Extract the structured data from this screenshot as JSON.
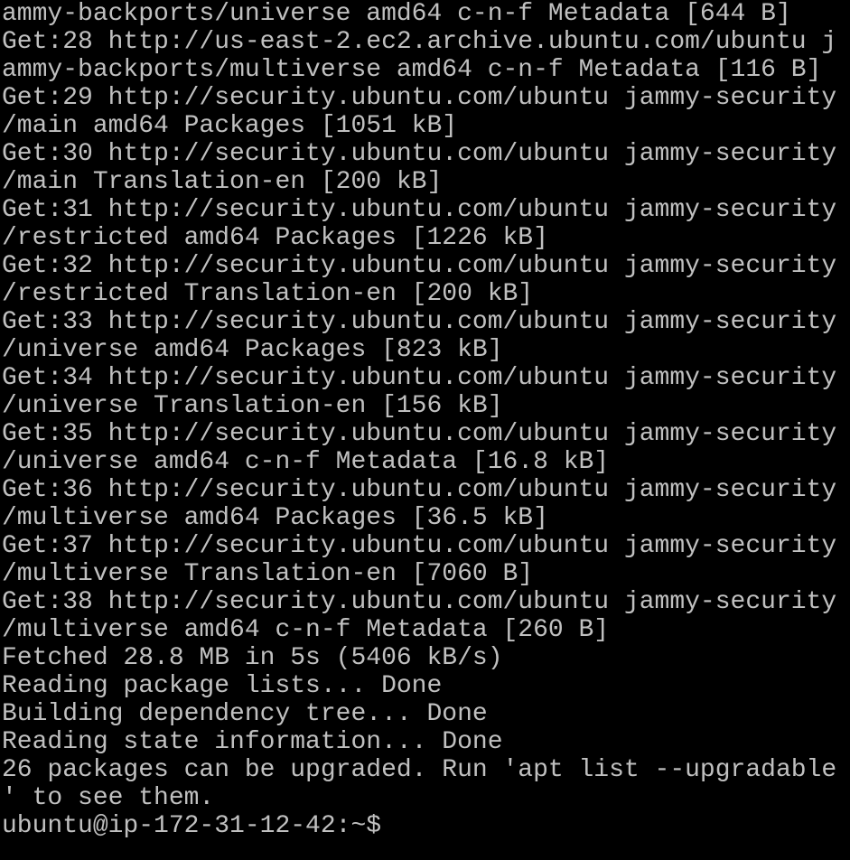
{
  "terminal": {
    "lines": [
      "ammy-backports/universe amd64 c-n-f Metadata [644 B]",
      "Get:28 http://us-east-2.ec2.archive.ubuntu.com/ubuntu j",
      "ammy-backports/multiverse amd64 c-n-f Metadata [116 B]",
      "Get:29 http://security.ubuntu.com/ubuntu jammy-security",
      "/main amd64 Packages [1051 kB]",
      "Get:30 http://security.ubuntu.com/ubuntu jammy-security",
      "/main Translation-en [200 kB]",
      "Get:31 http://security.ubuntu.com/ubuntu jammy-security",
      "/restricted amd64 Packages [1226 kB]",
      "Get:32 http://security.ubuntu.com/ubuntu jammy-security",
      "/restricted Translation-en [200 kB]",
      "Get:33 http://security.ubuntu.com/ubuntu jammy-security",
      "/universe amd64 Packages [823 kB]",
      "Get:34 http://security.ubuntu.com/ubuntu jammy-security",
      "/universe Translation-en [156 kB]",
      "Get:35 http://security.ubuntu.com/ubuntu jammy-security",
      "/universe amd64 c-n-f Metadata [16.8 kB]",
      "Get:36 http://security.ubuntu.com/ubuntu jammy-security",
      "/multiverse amd64 Packages [36.5 kB]",
      "Get:37 http://security.ubuntu.com/ubuntu jammy-security",
      "/multiverse Translation-en [7060 B]",
      "Get:38 http://security.ubuntu.com/ubuntu jammy-security",
      "/multiverse amd64 c-n-f Metadata [260 B]",
      "Fetched 28.8 MB in 5s (5406 kB/s)",
      "Reading package lists... Done",
      "Building dependency tree... Done",
      "Reading state information... Done",
      "26 packages can be upgraded. Run 'apt list --upgradable",
      "' to see them."
    ],
    "prompt": "ubuntu@ip-172-31-12-42:~$",
    "colors": {
      "background": "#000000",
      "foreground": "#c0c0c0"
    }
  }
}
